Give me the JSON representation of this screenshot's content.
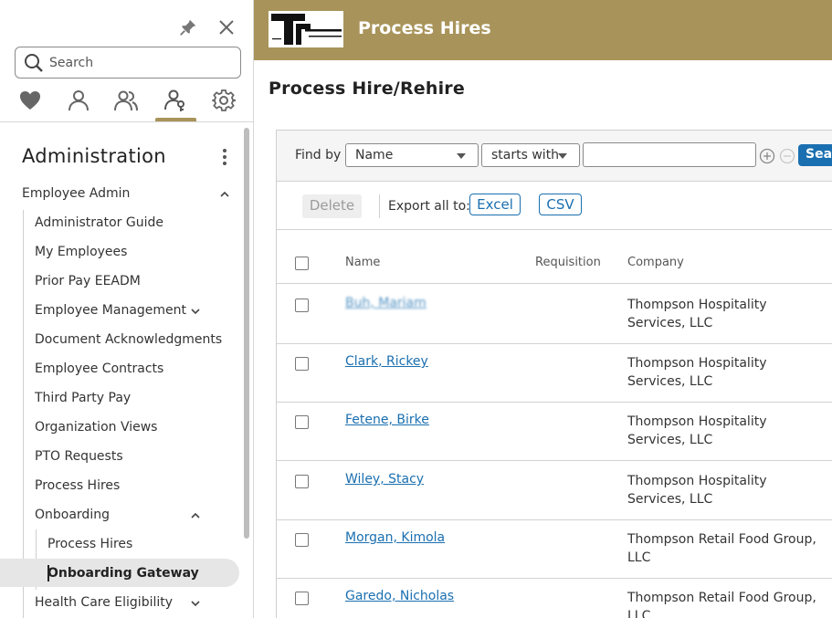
{
  "sidebar": {
    "search_placeholder": "Search",
    "nav_icons": [
      "heart-icon",
      "person-icon",
      "people-icon",
      "person-key-icon",
      "gear-icon"
    ],
    "section_title": "Administration",
    "items": [
      {
        "label": "Employee Admin",
        "expanded": true
      },
      {
        "label": "Administrator Guide"
      },
      {
        "label": "My Employees"
      },
      {
        "label": "Prior Pay EEADM"
      },
      {
        "label": "Employee Management",
        "expandable": true
      },
      {
        "label": "Document Acknowledgments"
      },
      {
        "label": "Employee Contracts"
      },
      {
        "label": "Third Party Pay"
      },
      {
        "label": "Organization Views"
      },
      {
        "label": "PTO Requests"
      },
      {
        "label": "Process Hires"
      },
      {
        "label": "Onboarding",
        "expanded": true
      },
      {
        "label": "Process Hires"
      },
      {
        "label": "Onboarding Gateway",
        "selected": true
      },
      {
        "label": "Health Care Eligibility",
        "expandable": true
      }
    ]
  },
  "header": {
    "logo_text": "THOMPSON HOSPITALITY",
    "title": "Process Hires",
    "brand_color": "#a8945a"
  },
  "page": {
    "title": "Process Hire/Rehire"
  },
  "find": {
    "label": "Find by",
    "field": "Name",
    "operator": "starts with",
    "value": "",
    "search_label": "Search"
  },
  "actions": {
    "delete_label": "Delete",
    "export_label": "Export all to:",
    "excel_label": "Excel",
    "csv_label": "CSV"
  },
  "table": {
    "columns": [
      "Name",
      "Requisition",
      "Company"
    ],
    "rows": [
      {
        "name": "Buh, Mariam",
        "requisition": "",
        "company": "Thompson Hospitality Services, LLC"
      },
      {
        "name": "Clark, Rickey",
        "requisition": "",
        "company": "Thompson Hospitality Services, LLC"
      },
      {
        "name": "Fetene, Birke",
        "requisition": "",
        "company": "Thompson Hospitality Services, LLC"
      },
      {
        "name": "Wiley, Stacy",
        "requisition": "",
        "company": "Thompson Hospitality Services, LLC"
      },
      {
        "name": "Morgan, Kimola",
        "requisition": "",
        "company": "Thompson Retail Food Group, LLC"
      },
      {
        "name": "Garedo, Nicholas",
        "requisition": "",
        "company": "Thompson Retail Food Group, LLC"
      }
    ]
  }
}
